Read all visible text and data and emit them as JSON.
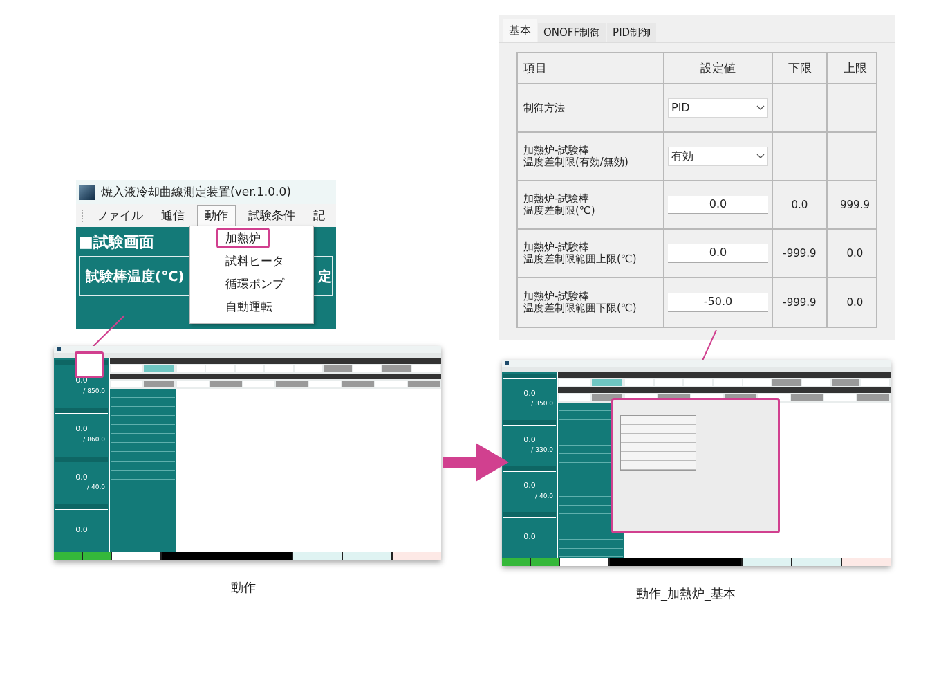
{
  "settings_panel": {
    "tabs": [
      {
        "label": "基本",
        "selected": true
      },
      {
        "label": "ONOFF制御",
        "selected": false
      },
      {
        "label": "PID制御",
        "selected": false
      }
    ],
    "columns": [
      "項目",
      "設定値",
      "下限",
      "上限"
    ],
    "rows": [
      {
        "item": [
          "制御方法"
        ],
        "kind": "dropdown",
        "value": "PID"
      },
      {
        "item": [
          "加熱炉-試験棒",
          "温度差制限(有効/無効)"
        ],
        "kind": "dropdown",
        "value": "有効"
      },
      {
        "item": [
          "加熱炉-試験棒",
          "温度差制限(℃)"
        ],
        "kind": "input",
        "value": "0.0",
        "lower": "0.0",
        "upper": "999.9"
      },
      {
        "item": [
          "加熱炉-試験棒",
          "温度差制限範囲上限(℃)"
        ],
        "kind": "input",
        "value": "0.0",
        "lower": "-999.9",
        "upper": "0.0"
      },
      {
        "item": [
          "加熱炉-試験棒",
          "温度差制限範囲下限(℃)"
        ],
        "kind": "input",
        "value": "-50.0",
        "lower": "-999.9",
        "upper": "0.0"
      }
    ]
  },
  "menu_callout": {
    "title": "焼入液冷却曲線測定装置(ver.1.0.0)",
    "menu": [
      {
        "label": "ファイル",
        "selected": false
      },
      {
        "label": "通信",
        "selected": false
      },
      {
        "label": "動作",
        "selected": true
      },
      {
        "label": "試験条件",
        "selected": false
      },
      {
        "label": "記",
        "selected": false
      }
    ],
    "screen_title": "■試験画面",
    "panel_label": "試験棒温度(℃)",
    "cut_text": "定",
    "dropdown": [
      {
        "label": "加熱炉",
        "selected": true
      },
      {
        "label": "試料ヒータ",
        "selected": false
      },
      {
        "label": "循環ポンプ",
        "selected": false
      },
      {
        "label": "自動運転",
        "selected": false
      }
    ]
  },
  "thumbnails": [
    {
      "kind": "menu_open",
      "caption": "動作",
      "readings": [
        {
          "value": "0.0",
          "limit": "/ 850.0"
        },
        {
          "value": "0.0",
          "limit": "/ 860.0"
        },
        {
          "value": "0.0",
          "limit": "/ 40.0"
        },
        {
          "value": "0.0"
        }
      ]
    },
    {
      "kind": "dialog_open",
      "caption": "動作_加熱炉_基本",
      "readings": [
        {
          "value": "0.0",
          "limit": "/ 350.0"
        },
        {
          "value": "0.0",
          "limit": "/ 330.0"
        },
        {
          "value": "0.0",
          "limit": "/ 40.0"
        },
        {
          "value": "0.0"
        }
      ]
    }
  ]
}
